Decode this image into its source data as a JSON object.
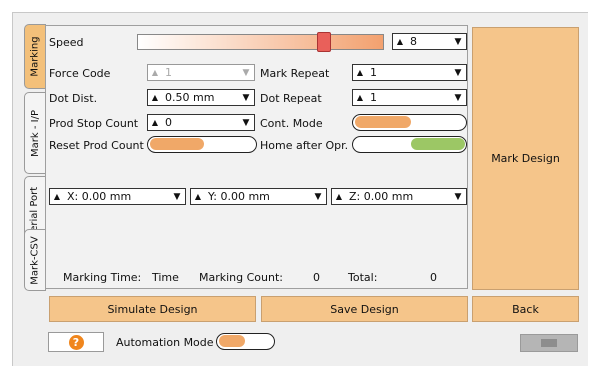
{
  "tabs": [
    {
      "label": "Marking"
    },
    {
      "label": "Mark - I/P"
    },
    {
      "label": "Serial Port"
    },
    {
      "label": "Mark-CSV"
    }
  ],
  "speed": {
    "label": "Speed",
    "level_percent": 76,
    "value": "8"
  },
  "force_code": {
    "label": "Force Code",
    "value": "1"
  },
  "dot_dist": {
    "label": "Dot Dist.",
    "value": "0.50 mm"
  },
  "prod_stop_count": {
    "label": "Prod Stop Count",
    "value": "0"
  },
  "reset_prod_count": {
    "label": "Reset Prod Count",
    "state": "on"
  },
  "mark_repeat": {
    "label": "Mark Repeat",
    "value": "1"
  },
  "dot_repeat": {
    "label": "Dot Repeat",
    "value": "1"
  },
  "cont_mode": {
    "label": "Cont. Mode",
    "state": "on"
  },
  "home_after_opr": {
    "label": "Home after Opr.",
    "state": "off"
  },
  "coords": {
    "x": "X: 0.00 mm",
    "y": "Y: 0.00 mm",
    "z": "Z: 0.00 mm"
  },
  "status": {
    "marking_time_label": "Marking Time:",
    "marking_time_value": "Time",
    "marking_count_label": "Marking Count:",
    "marking_count_value": "0",
    "total_label": "Total:",
    "total_value": "0"
  },
  "buttons": {
    "mark_design": "Mark Design",
    "simulate": "Simulate Design",
    "save": "Save Design",
    "back": "Back"
  },
  "automation": {
    "label": "Automation Mode",
    "state": "on"
  },
  "colors": {
    "accent": "#f5c58a",
    "toggle_on": "#f0a868",
    "toggle_green": "#9cc765",
    "slider_thumb": "#e9605a"
  }
}
